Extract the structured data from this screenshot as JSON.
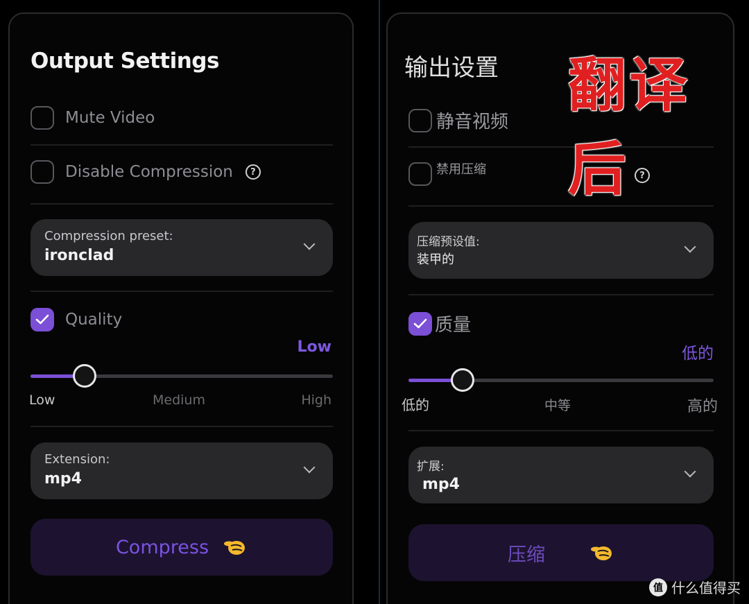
{
  "en": {
    "title": "Output Settings",
    "mute_label": "Mute Video",
    "disable_label": "Disable Compression",
    "preset_label": "Compression preset:",
    "preset_value": "ironclad",
    "quality_label": "Quality",
    "quality_level": "Low",
    "ticks": [
      "Low",
      "Medium",
      "High"
    ],
    "extension_label": "Extension:",
    "extension_value": "mp4",
    "compress_label": "Compress"
  },
  "zh": {
    "title": "输出设置",
    "mute_label": "静音视频",
    "disable_label": "禁用压缩",
    "preset_label": "压缩预设值:",
    "preset_value": "装甲的",
    "quality_label": "质量",
    "quality_level": "低的",
    "ticks": [
      "低的",
      "中等",
      "高的"
    ],
    "extension_label": "扩展:",
    "extension_value": "mp4",
    "compress_label": "压缩"
  },
  "watermark": "翻译后",
  "site_badge": "什么值得买",
  "state": {
    "mute_checked": false,
    "disable_checked": false,
    "quality_checked": true,
    "quality_slider_fraction": 0.18
  },
  "colors": {
    "accent": "#7b4fd6",
    "panel_bg": "#050505",
    "field_bg": "#28282b",
    "button_bg": "#1d1330"
  },
  "icons": [
    "help-circle-icon",
    "chevron-down-icon",
    "checkmark-icon",
    "hand-emoji-icon"
  ]
}
